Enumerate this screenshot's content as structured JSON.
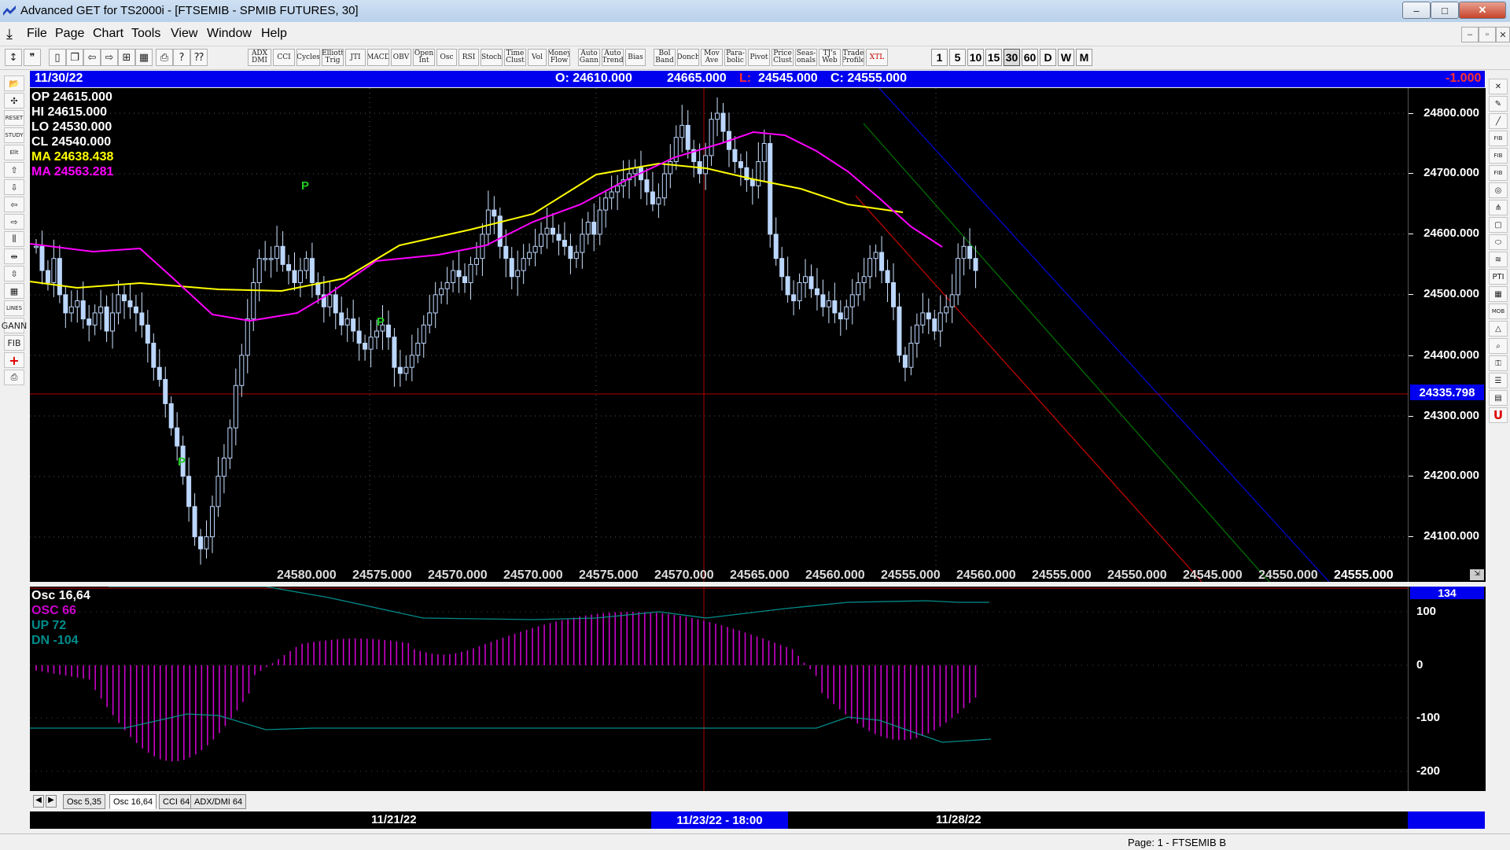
{
  "window": {
    "title": "Advanced GET for TS2000i - [FTSEMIB - SPMIB FUTURES, 30]",
    "minimize": "–",
    "maximize": "□",
    "close": "✕"
  },
  "menu": {
    "items": [
      "File",
      "Page",
      "Chart",
      "Tools",
      "View",
      "Window",
      "Help"
    ],
    "mdi_buttons": [
      "–",
      "▫",
      "✕"
    ]
  },
  "toolbar": {
    "study_buttons": [
      "ADX DMI",
      "CCI",
      "Cycles",
      "Elliott Trig",
      "JTI",
      "MACD",
      "OBV",
      "Open Int",
      "Osc",
      "RSI",
      "Stoch",
      "Time Clust",
      "Vol",
      "Money Flow",
      "Auto Gann",
      "Auto Trend",
      "Bias",
      "Bol Band",
      "Donch",
      "Mov Ave",
      "Para-bolic",
      "Pivot",
      "Price Clust",
      "Seas-onals",
      "TJ's Web",
      "Trade Profile",
      "XTL"
    ],
    "timeframes": [
      "1",
      "5",
      "10",
      "15",
      "30",
      "60",
      "D",
      "W",
      "M"
    ],
    "selected_timeframe": "30"
  },
  "left_toolbar": {
    "buttons": [
      "open-icon",
      "crosshair-icon",
      "reset",
      "study",
      "elliott",
      "up-arrow-icon",
      "down-arrow-icon",
      "left-arrow-icon",
      "right-arrow-icon",
      "bars-icon",
      "expand-icon",
      "compress-icon",
      "grid-icon",
      "lines",
      "gann",
      "fib",
      "add-icon",
      "print-icon"
    ]
  },
  "right_toolbar": {
    "buttons": [
      "cross-icon",
      "pencil-icon",
      "line-icon",
      "fib-ret",
      "fib-ext",
      "fib-time",
      "circle-icon",
      "fan-icon",
      "box-icon",
      "ellipse-icon",
      "wave-icon",
      "PTI",
      "grid-icon",
      "MOB",
      "triangle-icon",
      "zoom-icon",
      "key-icon",
      "list-icon",
      "book-icon",
      "U"
    ]
  },
  "header": {
    "date": "11/30/22",
    "open": "O: 24610.000",
    "high": "24665.000",
    "low_label": "L:",
    "low": "24545.000",
    "close": "C: 24555.000",
    "change": "-1.000"
  },
  "info_panel": {
    "op": "OP  24615.000",
    "hi": "HI   24615.000",
    "lo": "LO  24530.000",
    "cl": "CL  24540.000",
    "ma1": "MA  24638.438",
    "ma2": "MA  24563.281"
  },
  "price_axis": {
    "labels": [
      "24800.000",
      "24700.000",
      "24600.000",
      "24500.000",
      "24400.000",
      "24300.000",
      "24200.000",
      "24100.000"
    ],
    "crosshair_value": "24335.798"
  },
  "pivot_labels": [
    "24580.000",
    "24575.000",
    "24570.000",
    "24570.000",
    "24575.000",
    "24570.000",
    "24565.000",
    "24560.000",
    "24555.000",
    "24560.000",
    "24555.000",
    "24550.000",
    "24545.000",
    "24550.000",
    "24555.000"
  ],
  "pivot_markers": [
    "P",
    "P",
    "P"
  ],
  "oscillator": {
    "title": "Osc 16,64",
    "osc": "OSC 66",
    "up": "UP   72",
    "dn": "DN   -104",
    "axis_labels": [
      "100",
      "0",
      "-100",
      "-200"
    ],
    "current_value": "134"
  },
  "tabs": [
    "Osc 5,35",
    "Osc 16,64",
    "CCI 64",
    "ADX/DMI 64"
  ],
  "active_tab": "Osc 16,64",
  "date_axis": {
    "labels": [
      "11/21/22",
      "11/28/22"
    ],
    "cursor_label": "11/23/22 - 18:00"
  },
  "status": {
    "page": "Page: 1 - FTSEMIB B"
  },
  "colors": {
    "header_bg": "#0000ee",
    "ma_fast": "#ffff00",
    "ma_slow": "#ff00ff",
    "osc_hist": "#cc00cc",
    "osc_bands": "#008b8b",
    "channel_blue": "#0000cc",
    "channel_green": "#007700",
    "channel_red": "#cc0000"
  }
}
